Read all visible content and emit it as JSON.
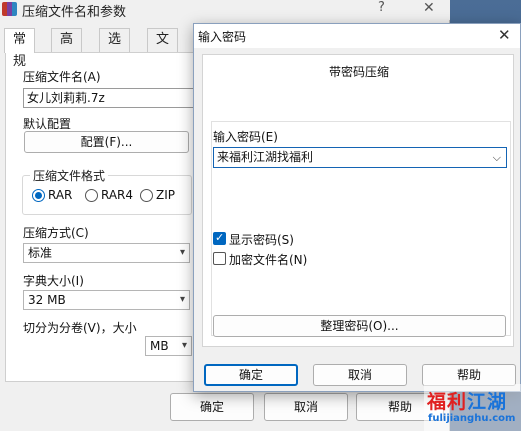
{
  "back_window": {
    "title": "压缩文件名和参数",
    "help_glyph": "?",
    "close_glyph": "✕",
    "tabs": [
      "常规",
      "高级",
      "选项",
      "文件"
    ],
    "archive_name_label": "压缩文件名(A)",
    "archive_name_value": "女儿刘莉莉.7z",
    "default_profile_label": "默认配置",
    "profiles_button": "配置(F)...",
    "format_group_label": "压缩文件格式",
    "formats": [
      {
        "label": "RAR",
        "selected": true
      },
      {
        "label": "RAR4",
        "selected": false
      },
      {
        "label": "ZIP",
        "selected": false
      }
    ],
    "method_label": "压缩方式(C)",
    "method_value": "标准",
    "dict_label": "字典大小(I)",
    "dict_value": "32 MB",
    "split_label": "切分为分卷(V)，大小",
    "split_unit": "MB",
    "buttons": {
      "ok": "确定",
      "cancel": "取消",
      "help": "帮助"
    }
  },
  "password_dialog": {
    "title": "输入密码",
    "close_glyph": "✕",
    "heading": "带密码压缩",
    "password_label": "输入密码(E)",
    "password_value": "来福利江湖找福利",
    "show_password_label": "显示密码(S)",
    "show_password_checked": true,
    "encrypt_names_label": "加密文件名(N)",
    "encrypt_names_checked": false,
    "organize_button": "整理密码(O)...",
    "buttons": {
      "ok": "确定",
      "cancel": "取消",
      "help": "帮助"
    }
  },
  "watermark": {
    "brand_red": "福利",
    "brand_blue": "江湖",
    "url": "fulijianghu.com"
  },
  "colors": {
    "accent": "#0067c0",
    "desktop": "#3b5f8a"
  },
  "icons": [
    "winrar-app-icon",
    "help-icon",
    "close-icon",
    "chevron-down-icon",
    "checkbox-icon",
    "radio-icon"
  ]
}
